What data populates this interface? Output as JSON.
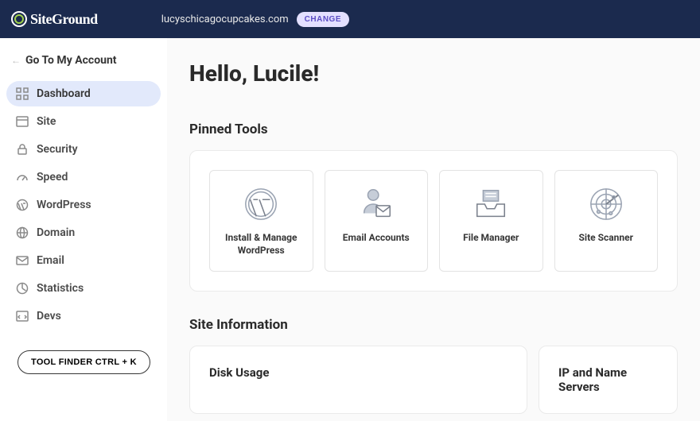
{
  "header": {
    "brand": "SiteGround",
    "domain": "lucyschicagocupcakes.com",
    "change_label": "CHANGE"
  },
  "sidebar": {
    "back_label": "Go To My Account",
    "items": [
      {
        "label": "Dashboard"
      },
      {
        "label": "Site"
      },
      {
        "label": "Security"
      },
      {
        "label": "Speed"
      },
      {
        "label": "WordPress"
      },
      {
        "label": "Domain"
      },
      {
        "label": "Email"
      },
      {
        "label": "Statistics"
      },
      {
        "label": "Devs"
      }
    ],
    "tool_finder_label": "TOOL FINDER CTRL + K"
  },
  "main": {
    "greeting": "Hello, Lucile!",
    "pinned_title": "Pinned Tools",
    "tools": [
      {
        "label": "Install & Manage WordPress"
      },
      {
        "label": "Email Accounts"
      },
      {
        "label": "File Manager"
      },
      {
        "label": "Site Scanner"
      }
    ],
    "site_info_title": "Site Information",
    "panels": {
      "disk_title": "Disk Usage",
      "ip_title": "IP and Name Servers"
    }
  }
}
